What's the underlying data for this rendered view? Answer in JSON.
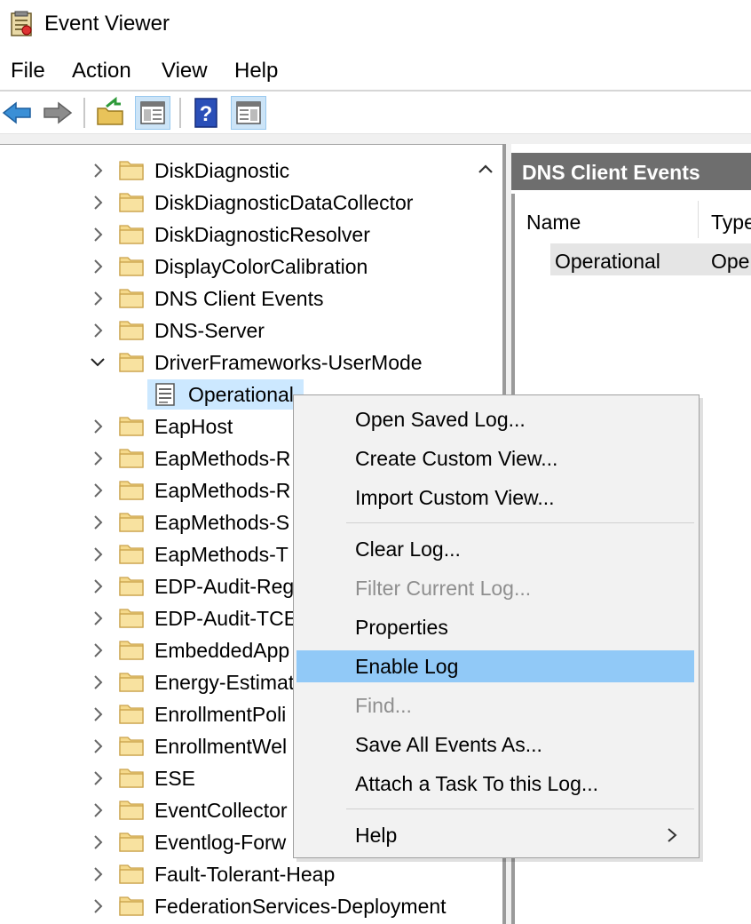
{
  "window": {
    "title": "Event Viewer",
    "icon": "event-viewer-icon"
  },
  "menu": {
    "items": [
      "File",
      "Action",
      "View",
      "Help"
    ]
  },
  "toolbar": {
    "buttons": [
      "back-arrow-icon",
      "forward-arrow-icon",
      "open-folder-icon",
      "show-hide-tree-icon",
      "help-icon",
      "show-hide-action-pane-icon"
    ]
  },
  "tree": {
    "items": [
      {
        "label": "DiskDiagnostic",
        "expanded": false
      },
      {
        "label": "DiskDiagnosticDataCollector",
        "expanded": false
      },
      {
        "label": "DiskDiagnosticResolver",
        "expanded": false
      },
      {
        "label": "DisplayColorCalibration",
        "expanded": false
      },
      {
        "label": "DNS Client Events",
        "expanded": false
      },
      {
        "label": "DNS-Server",
        "expanded": false
      },
      {
        "label": "DriverFrameworks-UserMode",
        "expanded": true
      },
      {
        "label": "EapHost",
        "expanded": false
      },
      {
        "label": "EapMethods-R",
        "expanded": false
      },
      {
        "label": "EapMethods-R",
        "expanded": false
      },
      {
        "label": "EapMethods-S",
        "expanded": false
      },
      {
        "label": "EapMethods-T",
        "expanded": false
      },
      {
        "label": "EDP-Audit-Reg",
        "expanded": false
      },
      {
        "label": "EDP-Audit-TCE",
        "expanded": false
      },
      {
        "label": "EmbeddedApp",
        "expanded": false
      },
      {
        "label": "Energy-Estimat",
        "expanded": false
      },
      {
        "label": "EnrollmentPoli",
        "expanded": false
      },
      {
        "label": "EnrollmentWel",
        "expanded": false
      },
      {
        "label": "ESE",
        "expanded": false
      },
      {
        "label": "EventCollector",
        "expanded": false
      },
      {
        "label": "Eventlog-Forw",
        "expanded": false
      },
      {
        "label": "Fault-Tolerant-Heap",
        "expanded": false
      },
      {
        "label": "FederationServices-Deployment",
        "expanded": false
      }
    ],
    "selected_child": {
      "label": "Operational"
    }
  },
  "right_pane": {
    "title": "DNS Client Events",
    "columns": [
      "Name",
      "Type"
    ],
    "rows": [
      {
        "name": "Operational",
        "type": "Ope"
      }
    ]
  },
  "context_menu": {
    "items": [
      {
        "label": "Open Saved Log...",
        "state": "normal"
      },
      {
        "label": "Create Custom View...",
        "state": "normal"
      },
      {
        "label": "Import Custom View...",
        "state": "normal"
      },
      {
        "label": "Clear Log...",
        "state": "normal"
      },
      {
        "label": "Filter Current Log...",
        "state": "disabled"
      },
      {
        "label": "Properties",
        "state": "normal"
      },
      {
        "label": "Enable Log",
        "state": "highlighted"
      },
      {
        "label": "Find...",
        "state": "disabled"
      },
      {
        "label": "Save All Events As...",
        "state": "normal"
      },
      {
        "label": "Attach a Task To this Log...",
        "state": "normal"
      },
      {
        "label": "Help",
        "state": "normal",
        "submenu": true
      }
    ]
  }
}
